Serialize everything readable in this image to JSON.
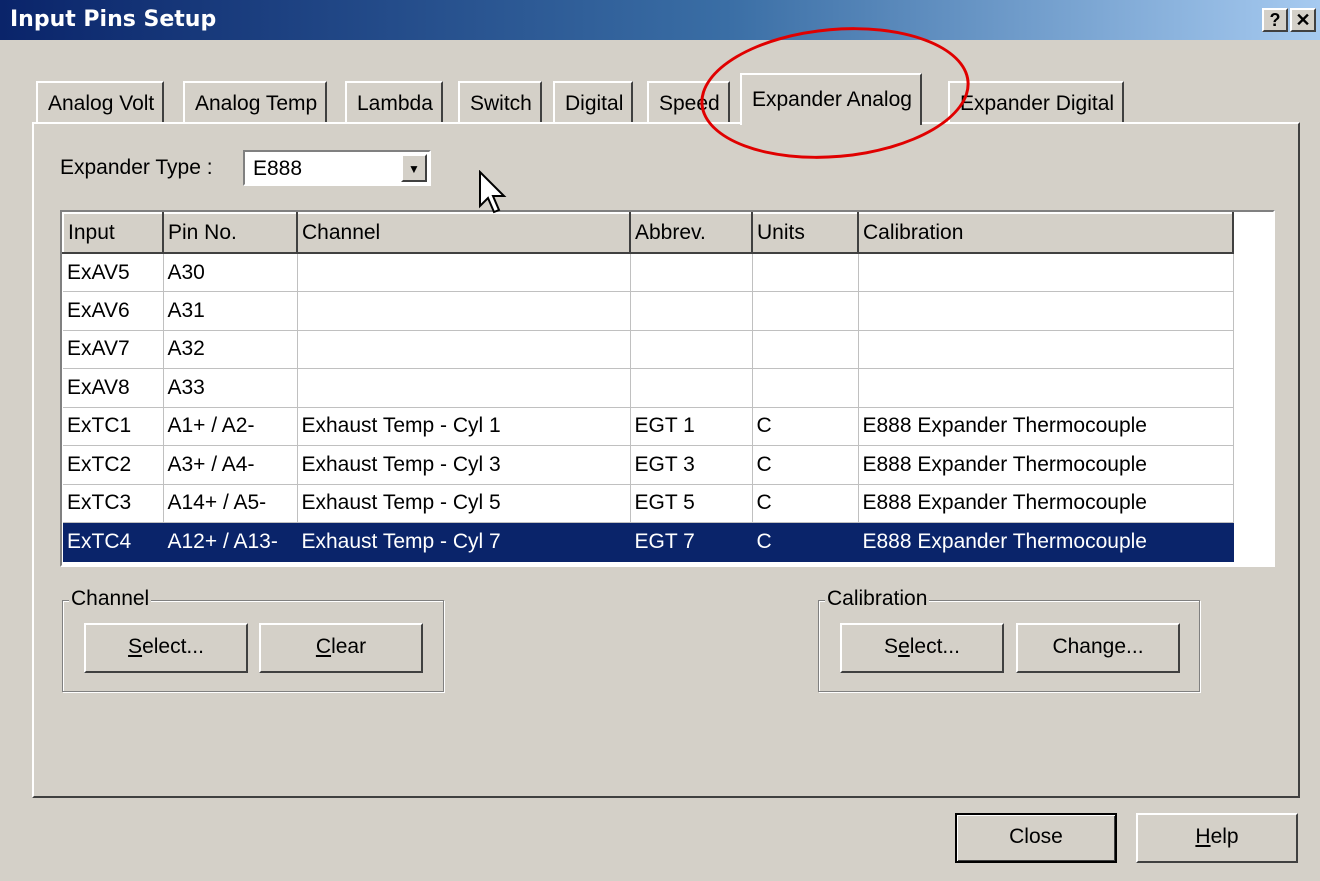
{
  "window": {
    "title": "Input Pins Setup",
    "help_btn": "?",
    "close_btn": "✕"
  },
  "tabs": [
    "Analog Volt",
    "Analog Temp",
    "Lambda",
    "Switch",
    "Digital",
    "Speed",
    "Expander Analog",
    "Expander Digital"
  ],
  "active_tab": "Expander Analog",
  "expander": {
    "label": "Expander Type :",
    "value": "E888"
  },
  "grid": {
    "columns": [
      "Input",
      "Pin No.",
      "Channel",
      "Abbrev.",
      "Units",
      "Calibration"
    ],
    "rows": [
      [
        "ExAV5",
        "A30",
        "",
        "",
        "",
        ""
      ],
      [
        "ExAV6",
        "A31",
        "",
        "",
        "",
        ""
      ],
      [
        "ExAV7",
        "A32",
        "",
        "",
        "",
        ""
      ],
      [
        "ExAV8",
        "A33",
        "",
        "",
        "",
        ""
      ],
      [
        "ExTC1",
        "A1+ / A2-",
        "Exhaust Temp - Cyl  1",
        "EGT 1",
        "C",
        "E888 Expander Thermocouple"
      ],
      [
        "ExTC2",
        "A3+ / A4-",
        "Exhaust Temp - Cyl  3",
        "EGT 3",
        "C",
        "E888 Expander Thermocouple"
      ],
      [
        "ExTC3",
        "A14+ / A5-",
        "Exhaust Temp - Cyl  5",
        "EGT 5",
        "C",
        "E888 Expander Thermocouple"
      ],
      [
        "ExTC4",
        "A12+ / A13-",
        "Exhaust Temp - Cyl  7",
        "EGT 7",
        "C",
        "E888 Expander Thermocouple"
      ]
    ],
    "selected_row": 7
  },
  "channel_group": {
    "label": "Channel",
    "select_pre": "",
    "select_u": "S",
    "select_post": "elect...",
    "clear_pre": "",
    "clear_u": "C",
    "clear_post": "lear"
  },
  "calibration_group": {
    "label": "Calibration",
    "select_pre": "S",
    "select_u": "e",
    "select_post": "lect...",
    "change_pre": "Chan",
    "change_u": "g",
    "change_post": "e..."
  },
  "footer": {
    "close": "Close",
    "help_u": "H",
    "help_post": "elp"
  },
  "colors": {
    "selection": "#0a246a",
    "annotation": "#e00000"
  }
}
